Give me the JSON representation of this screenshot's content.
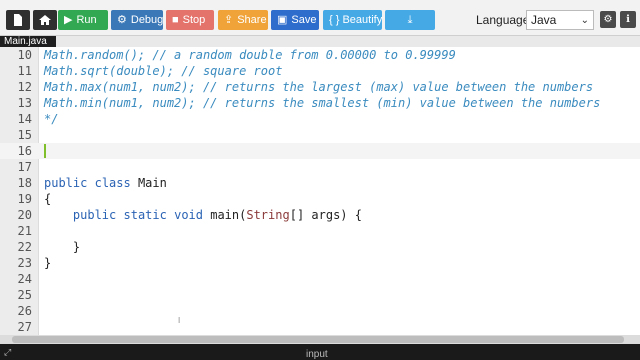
{
  "toolbar": {
    "run_label": "Run",
    "debug_label": "Debug",
    "stop_label": "Stop",
    "share_label": "Share",
    "save_label": "Save",
    "beautify_label": "{ } Beautify",
    "language_label": "Language",
    "language_value": "Java"
  },
  "colors": {
    "run": "#33a852",
    "debug": "#3a78b8",
    "stop": "#e3736b",
    "share": "#f0a338",
    "save": "#2e6dcc",
    "beautify": "#45a9e6",
    "download": "#45a9e6"
  },
  "tab": {
    "file_name": "Main.java"
  },
  "editor": {
    "lines": [
      {
        "num": "10",
        "text": "Math.random(); // a random double from 0.00000 to 0.99999",
        "style": "comment"
      },
      {
        "num": "11",
        "text": "Math.sqrt(double); // square root",
        "style": "comment"
      },
      {
        "num": "12",
        "text": "Math.max(num1, num2); // returns the largest (max) value between the numbers",
        "style": "comment"
      },
      {
        "num": "13",
        "text": "Math.min(num1, num2); // returns the smallest (min) value between the numbers",
        "style": "comment"
      },
      {
        "num": "14",
        "text": "*/",
        "style": "comment"
      },
      {
        "num": "15",
        "text": "",
        "style": "plain"
      },
      {
        "num": "16",
        "text": "",
        "style": "plain"
      },
      {
        "num": "17",
        "text": "",
        "style": "plain"
      },
      {
        "num": "18",
        "text": "public class Main",
        "style": "plain"
      },
      {
        "num": "19",
        "text": "{",
        "style": "plain"
      },
      {
        "num": "20",
        "text": "    public static void main(String[] args) {",
        "style": "plain"
      },
      {
        "num": "21",
        "text": "",
        "style": "plain"
      },
      {
        "num": "22",
        "text": "    }",
        "style": "plain"
      },
      {
        "num": "23",
        "text": "}",
        "style": "plain"
      },
      {
        "num": "24",
        "text": "",
        "style": "plain"
      },
      {
        "num": "25",
        "text": "",
        "style": "plain"
      },
      {
        "num": "26",
        "text": "",
        "style": "plain"
      },
      {
        "num": "27",
        "text": "",
        "style": "plain"
      }
    ]
  },
  "bottom": {
    "input_label": "input"
  }
}
